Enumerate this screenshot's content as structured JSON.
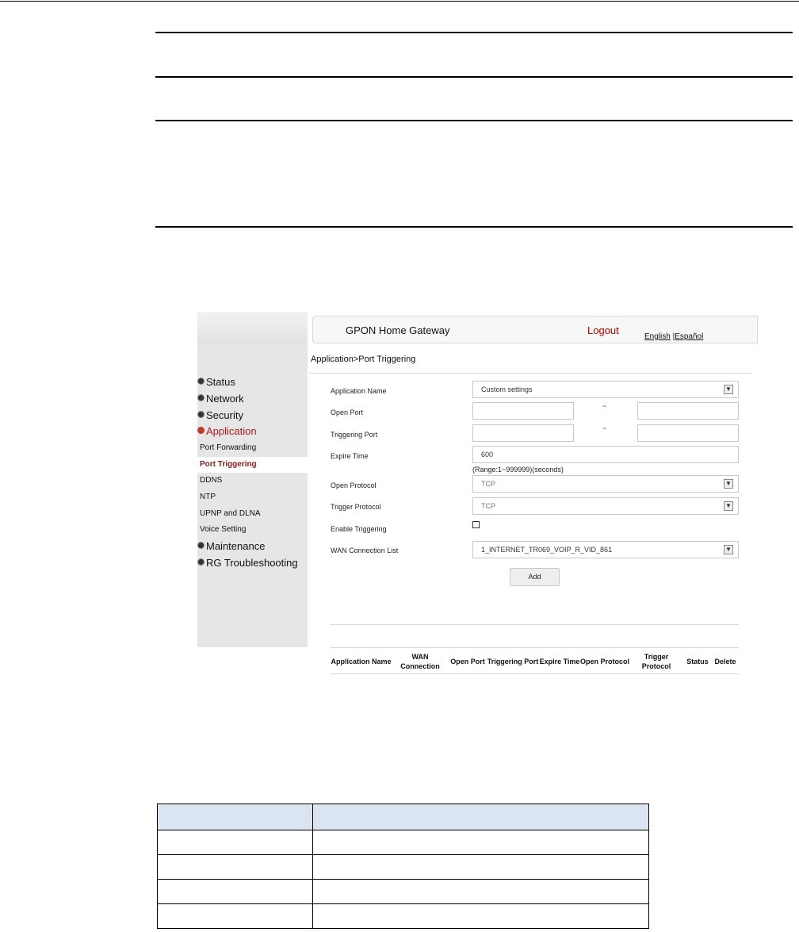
{
  "gateway": {
    "title": "GPON Home Gateway",
    "logout": "Logout",
    "lang_english": "English",
    "lang_sep": " |",
    "lang_spanish": "Español",
    "breadcrumb": "Application>Port Triggering"
  },
  "menu": {
    "status": "Status",
    "network": "Network",
    "security": "Security",
    "application": "Application",
    "port_forwarding": "Port Forwarding",
    "port_triggering": "Port Triggering",
    "ddns": "DDNS",
    "ntp": "NTP",
    "upnp": "UPNP and DLNA",
    "voice": "Voice Setting",
    "maintenance": "Maintenance",
    "rg_troubleshooting": "RG Troubleshooting"
  },
  "form": {
    "app_name_label": "Application Name",
    "app_name_value": "Custom settings",
    "open_port_label": "Open Port",
    "open_port_sep": "~",
    "triggering_port_label": "Triggering Port",
    "triggering_port_sep": "~",
    "expire_label": "Expire Time",
    "expire_value": "600",
    "expire_hint": "(Range:1~999999)(seconds)",
    "open_protocol_label": "Open Protocol",
    "open_protocol_value": "TCP",
    "trigger_protocol_label": "Trigger Protocol",
    "trigger_protocol_value": "TCP",
    "enable_label": "Enable Triggering",
    "wan_label": "WAN Connection List",
    "wan_value": "1_INTERNET_TR069_VOIP_R_VID_861",
    "add_button": "Add"
  },
  "table": {
    "columns": [
      "Application Name",
      "WAN Connection",
      "Open Port",
      "Triggering Port",
      "Expire Time",
      "Open Protocol",
      "Trigger Protocol",
      "Status",
      "Delete"
    ]
  }
}
